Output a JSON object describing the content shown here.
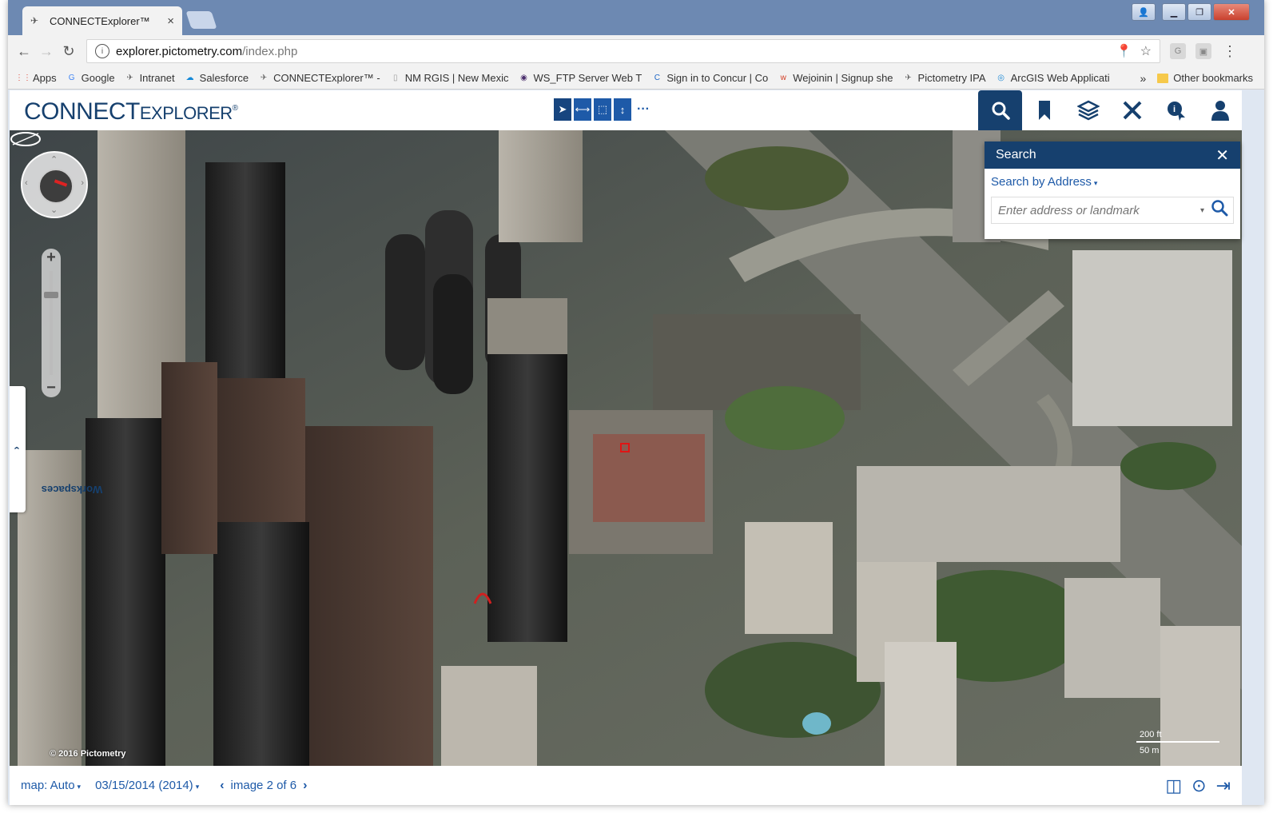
{
  "browser": {
    "tab_title": "CONNECTExplorer™",
    "url_host": "explorer.pictometry.com",
    "url_path": "/index.php",
    "bookmarks": [
      {
        "label": "Apps",
        "icon": "apps-icon",
        "color": "#e04b3c"
      },
      {
        "label": "Google",
        "icon": "google-icon",
        "color": "#4285f4"
      },
      {
        "label": "Intranet",
        "icon": "pictometry-icon",
        "color": "#666666"
      },
      {
        "label": "Salesforce",
        "icon": "salesforce-cloud-icon",
        "color": "#1589d8"
      },
      {
        "label": "CONNECTExplorer™ -",
        "icon": "pictometry-icon",
        "color": "#666666"
      },
      {
        "label": "NM RGIS | New Mexic",
        "icon": "page-icon",
        "color": "#999999"
      },
      {
        "label": "WS_FTP Server Web T",
        "icon": "ftp-icon",
        "color": "#4b2f6d"
      },
      {
        "label": "Sign in to Concur | Co",
        "icon": "concur-icon",
        "color": "#1f67c6"
      },
      {
        "label": "Wejoinin | Signup she",
        "icon": "wejoinin-icon",
        "color": "#d23b22"
      },
      {
        "label": "Pictometry IPA",
        "icon": "pictometry-icon",
        "color": "#666666"
      },
      {
        "label": "ArcGIS Web Applicati",
        "icon": "arcgis-icon",
        "color": "#1f8ad6"
      }
    ],
    "more_label": "»",
    "other_bookmarks": "Other bookmarks"
  },
  "app": {
    "logo_main": "CONNECT",
    "logo_rest": "EXPLORER",
    "logo_tm": "®",
    "toolbar_tools": [
      "select-arrow-icon",
      "measure-distance-icon",
      "measure-area-icon",
      "measure-height-icon"
    ],
    "toolbar_more": "···",
    "top_icons": [
      "search-icon",
      "bookmark-icon",
      "layers-icon",
      "tools-icon",
      "identify-icon",
      "user-icon"
    ],
    "accent": "#16406e",
    "link_color": "#1e5aa8"
  },
  "search": {
    "title": "Search",
    "close": "✕",
    "by_label": "Search by",
    "by_value": "Address",
    "placeholder": "Enter address or landmark"
  },
  "map": {
    "workspaces_label": "Workspaces",
    "copyright": "© 2016 Pictometry",
    "scale_top": "200 ft",
    "scale_bottom": "50 m"
  },
  "bottom": {
    "map_mode": "map: Auto",
    "date": "03/15/2014 (2014)",
    "image_label": "image 2 of 6"
  }
}
